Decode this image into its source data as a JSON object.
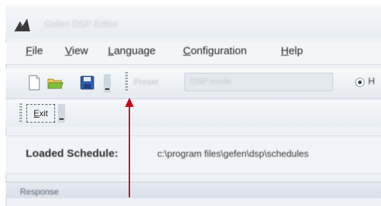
{
  "window": {
    "title": "Gefen DSP Editor"
  },
  "menu": {
    "items": [
      {
        "label": "File",
        "underline": "F",
        "rest": "ile"
      },
      {
        "label": "View",
        "underline": "V",
        "rest": "iew"
      },
      {
        "label": "Language",
        "underline": "L",
        "rest": "anguage"
      },
      {
        "label": "Configuration",
        "underline": "C",
        "rest": "onfiguration"
      },
      {
        "label": "Help",
        "underline": "H",
        "rest": "elp"
      }
    ]
  },
  "toolbar": {
    "icons": [
      "new-file-icon",
      "open-folder-icon",
      "save-disk-icon"
    ],
    "combo_label": "Preset",
    "combo_value": "DSP mode",
    "radio_label": "H"
  },
  "toolbar2": {
    "exit_label_underline": "E",
    "exit_label_rest": "xit"
  },
  "schedule": {
    "label": "Loaded Schedule:",
    "path": "c:\\program files\\gefen\\dsp\\schedules"
  },
  "bottom": {
    "label": "Response"
  },
  "colors": {
    "annotation_arrow": "#d0021b",
    "accent_folder": "#7fbf3a",
    "accent_disk": "#2f5fb0"
  }
}
